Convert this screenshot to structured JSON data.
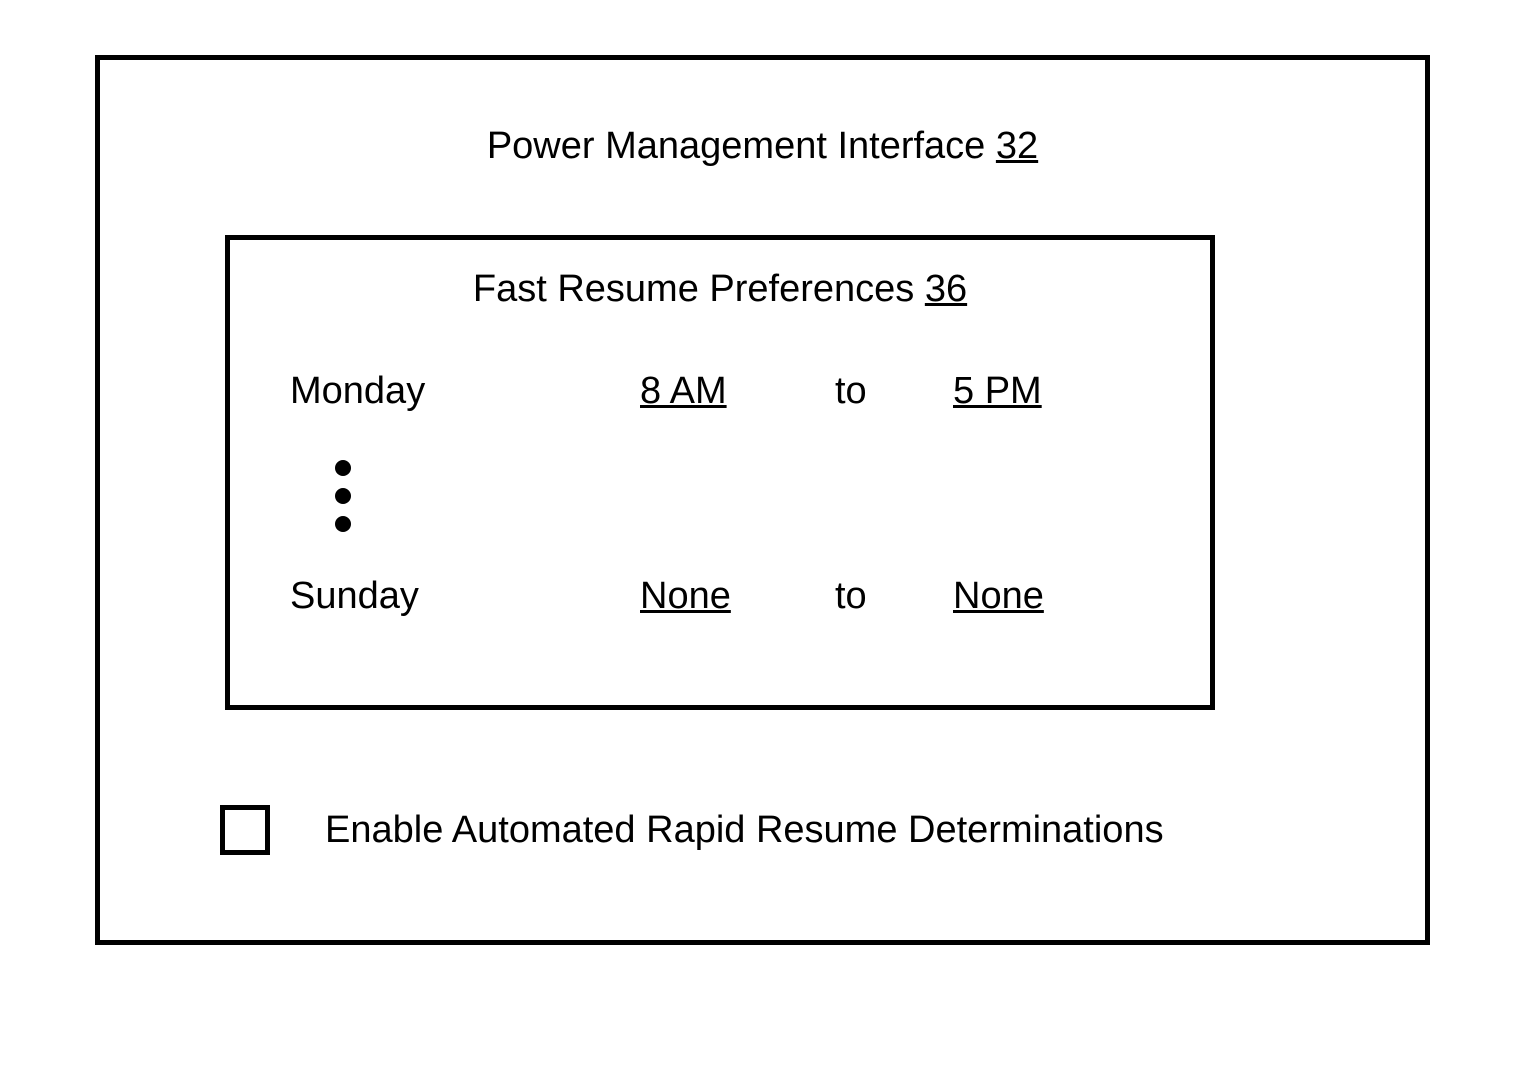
{
  "title": {
    "text": "Power Management Interface",
    "ref": "32"
  },
  "preferences": {
    "title_text": "Fast Resume Preferences",
    "title_ref": "36",
    "rows": [
      {
        "day": "Monday",
        "start": "8 AM",
        "to": "to",
        "end": "5 PM"
      },
      {
        "day": "Sunday",
        "start": "None",
        "to": "to",
        "end": "None"
      }
    ]
  },
  "checkbox": {
    "label": "Enable Automated Rapid Resume Determinations",
    "checked": false
  }
}
